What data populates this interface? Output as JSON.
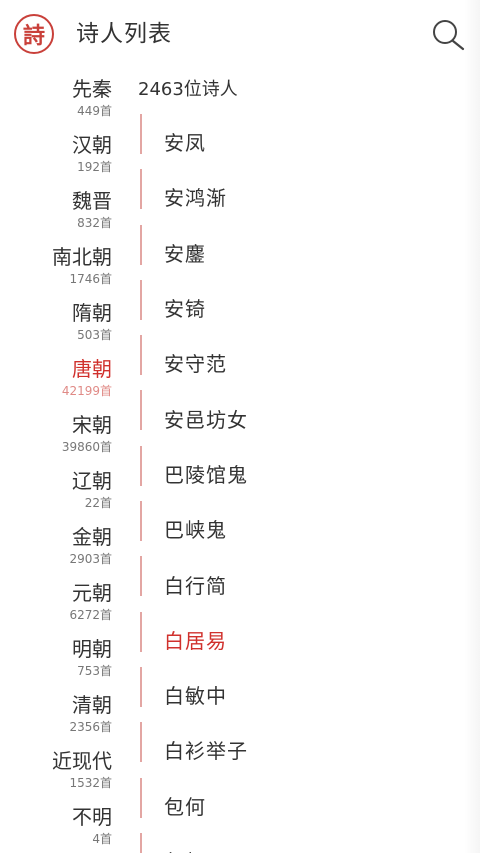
{
  "header": {
    "logo_char": "詩",
    "title": "诗人列表",
    "search_icon": "search-icon"
  },
  "dynasties": [
    {
      "name": "先秦",
      "count": "449首"
    },
    {
      "name": "汉朝",
      "count": "192首"
    },
    {
      "name": "魏晋",
      "count": "832首"
    },
    {
      "name": "南北朝",
      "count": "1746首"
    },
    {
      "name": "隋朝",
      "count": "503首"
    },
    {
      "name": "唐朝",
      "count": "42199首"
    },
    {
      "name": "宋朝",
      "count": "39860首"
    },
    {
      "name": "辽朝",
      "count": "22首"
    },
    {
      "name": "金朝",
      "count": "2903首"
    },
    {
      "name": "元朝",
      "count": "6272首"
    },
    {
      "name": "明朝",
      "count": "753首"
    },
    {
      "name": "清朝",
      "count": "2356首"
    },
    {
      "name": "近现代",
      "count": "1532首"
    },
    {
      "name": "不明",
      "count": "4首"
    }
  ],
  "active_dynasty": "唐朝",
  "poets": {
    "total": "2463位诗人",
    "items": [
      "安凤",
      "安鸿渐",
      "安鏖",
      "安锜",
      "安守范",
      "安邑坊女",
      "巴陵馆鬼",
      "巴峡鬼",
      "白行简",
      "白居易",
      "白敏中",
      "白衫举子",
      "包何",
      "包贺"
    ],
    "active": "白居易"
  },
  "colors": {
    "accent": "#d0312d",
    "divider": "#e3a6a3",
    "text": "#333333",
    "muted": "#777777"
  }
}
